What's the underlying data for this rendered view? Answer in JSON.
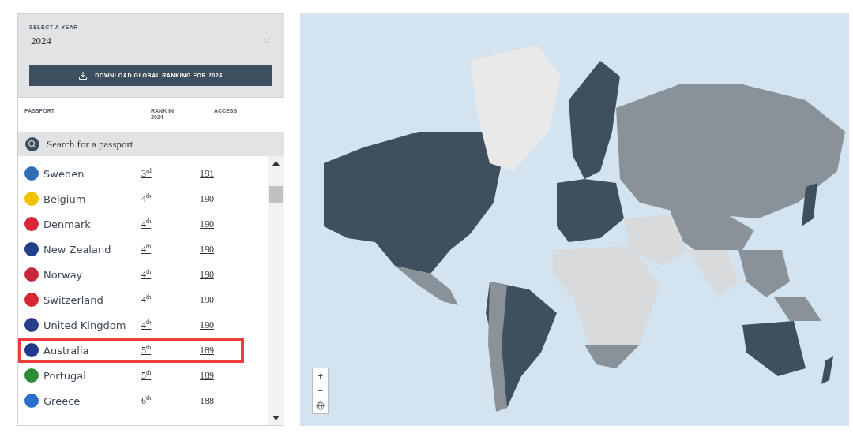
{
  "year_select": {
    "label": "SELECT A YEAR",
    "value": "2024"
  },
  "download_button": {
    "label": "DOWNLOAD GLOBAL RANKING FOR 2024"
  },
  "table": {
    "columns": [
      "PASSPORT",
      "RANK IN 2024",
      "ACCESS"
    ],
    "search": {
      "placeholder": "Search for a passport"
    },
    "rows": [
      {
        "passport": "Sweden",
        "rank": "3$^{rd}$",
        "access": "191",
        "color": "#2f6fb5",
        "highlighted": false
      },
      {
        "passport": "Belgium",
        "rank": "4$^{th}$",
        "access": "190",
        "color": "#f2c200",
        "highlighted": false
      },
      {
        "passport": "Denmark",
        "rank": "4$^{th}$",
        "access": "190",
        "color": "#d62839",
        "highlighted": false
      },
      {
        "passport": "New Zealand",
        "rank": "4$^{th}$",
        "access": "190",
        "color": "#1f3f8a",
        "highlighted": false
      },
      {
        "passport": "Norway",
        "rank": "4$^{th}$",
        "access": "190",
        "color": "#c8263a",
        "highlighted": false
      },
      {
        "passport": "Switzerland",
        "rank": "4$^{th}$",
        "access": "190",
        "color": "#d8282f",
        "highlighted": false
      },
      {
        "passport": "United Kingdom",
        "rank": "4$^{th}$",
        "access": "190",
        "color": "#2a3f8a",
        "highlighted": false
      },
      {
        "passport": "Australia",
        "rank": "5$^{th}$",
        "access": "189",
        "color": "#1f3a8a",
        "highlighted": true
      },
      {
        "passport": "Portugal",
        "rank": "5$^{th}$",
        "access": "189",
        "color": "#2e8b3a",
        "highlighted": false
      },
      {
        "passport": "Greece",
        "rank": "6$^{th}$",
        "access": "188",
        "color": "#2d6fc4",
        "highlighted": false
      }
    ]
  },
  "map_controls": {
    "zoom_in": "+",
    "zoom_out": "−"
  }
}
